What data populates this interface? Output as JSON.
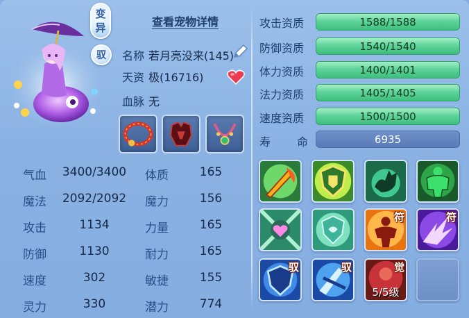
{
  "pet": {
    "badge_variant_line1": "变",
    "badge_variant_line2": "异",
    "badge_tame": "驭",
    "detail_link": "查看宠物详情",
    "name_label": "名称",
    "name_value": "若月亮没来(145)",
    "talent_label": "天资",
    "talent_value": "极(16716)",
    "bloodline_label": "血脉",
    "bloodline_value": "无"
  },
  "equipment": [
    {
      "name": "red-collar"
    },
    {
      "name": "dark-armor"
    },
    {
      "name": "jade-necklace"
    }
  ],
  "stats": {
    "hp_label": "气血",
    "hp_value": "3400/3400",
    "mp_label": "魔法",
    "mp_value": "2092/2092",
    "atk_label": "攻击",
    "atk_value": "1134",
    "def_label": "防御",
    "def_value": "1130",
    "spd_label": "速度",
    "spd_value": "302",
    "spirit_label": "灵力",
    "spirit_value": "330",
    "con_label": "体质",
    "con_value": "165",
    "mag_label": "魔力",
    "mag_value": "156",
    "str_label": "力量",
    "str_value": "165",
    "end_label": "耐力",
    "end_value": "165",
    "agi_label": "敏捷",
    "agi_value": "155",
    "pot_label": "潜力",
    "pot_value": "774"
  },
  "aptitude": [
    {
      "label": "攻击资质",
      "value": "1588/1588",
      "fraction": 1.0
    },
    {
      "label": "防御资质",
      "value": "1540/1540",
      "fraction": 1.0
    },
    {
      "label": "体力资质",
      "value": "1400/1401",
      "fraction": 0.999
    },
    {
      "label": "法力资质",
      "value": "1405/1405",
      "fraction": 1.0
    },
    {
      "label": "速度资质",
      "value": "1500/1500",
      "fraction": 1.0
    }
  ],
  "life": {
    "label_1": "寿",
    "label_2": "命",
    "value": "6935"
  },
  "skills": {
    "s7_corner": "符",
    "s8_corner": "符",
    "s9_corner": "驭",
    "s10_corner": "驭",
    "s11_corner": "觉",
    "s11_level": "5/5级"
  },
  "colors": {
    "apt_bar": "#5fd39a",
    "life_bar": "#5a7bb8",
    "panel_bg": "#8bb2e3",
    "text_dark": "#1c3a66"
  }
}
